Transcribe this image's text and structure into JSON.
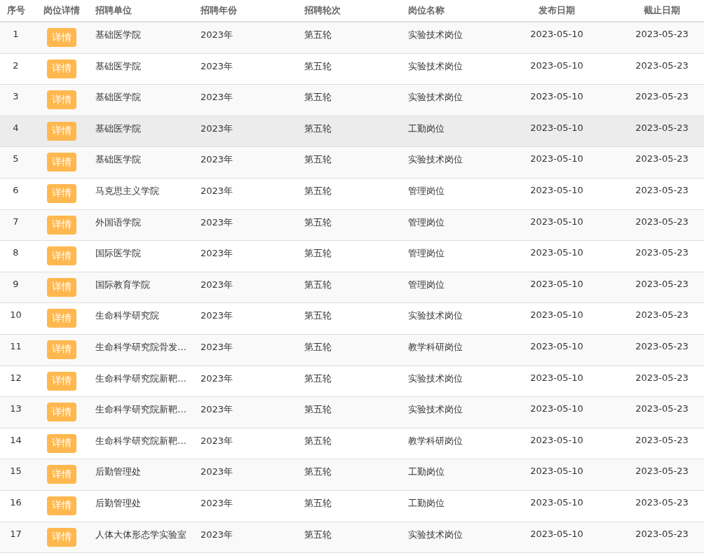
{
  "table": {
    "columns": [
      "序号",
      "岗位详情",
      "招聘单位",
      "招聘年份",
      "招聘轮次",
      "岗位名称",
      "发布日期",
      "截止日期"
    ],
    "rows": [
      {
        "index": "1",
        "button": "详情",
        "unit": "基础医学院",
        "year": "2023年",
        "round": "第五轮",
        "position": "实验技术岗位",
        "published": "2023-05-10",
        "deadline": "2023-05-23",
        "hovered": false
      },
      {
        "index": "2",
        "button": "详情",
        "unit": "基础医学院",
        "year": "2023年",
        "round": "第五轮",
        "position": "实验技术岗位",
        "published": "2023-05-10",
        "deadline": "2023-05-23",
        "hovered": false
      },
      {
        "index": "3",
        "button": "详情",
        "unit": "基础医学院",
        "year": "2023年",
        "round": "第五轮",
        "position": "实验技术岗位",
        "published": "2023-05-10",
        "deadline": "2023-05-23",
        "hovered": false
      },
      {
        "index": "4",
        "button": "详情",
        "unit": "基础医学院",
        "year": "2023年",
        "round": "第五轮",
        "position": "工勤岗位",
        "published": "2023-05-10",
        "deadline": "2023-05-23",
        "hovered": true
      },
      {
        "index": "5",
        "button": "详情",
        "unit": "基础医学院",
        "year": "2023年",
        "round": "第五轮",
        "position": "实验技术岗位",
        "published": "2023-05-10",
        "deadline": "2023-05-23",
        "hovered": false
      },
      {
        "index": "6",
        "button": "详情",
        "unit": "马克思主义学院",
        "year": "2023年",
        "round": "第五轮",
        "position": "管理岗位",
        "published": "2023-05-10",
        "deadline": "2023-05-23",
        "hovered": false
      },
      {
        "index": "7",
        "button": "详情",
        "unit": "外国语学院",
        "year": "2023年",
        "round": "第五轮",
        "position": "管理岗位",
        "published": "2023-05-10",
        "deadline": "2023-05-23",
        "hovered": false
      },
      {
        "index": "8",
        "button": "详情",
        "unit": "国际医学院",
        "year": "2023年",
        "round": "第五轮",
        "position": "管理岗位",
        "published": "2023-05-10",
        "deadline": "2023-05-23",
        "hovered": false
      },
      {
        "index": "9",
        "button": "详情",
        "unit": "国际教育学院",
        "year": "2023年",
        "round": "第五轮",
        "position": "管理岗位",
        "published": "2023-05-10",
        "deadline": "2023-05-23",
        "hovered": false
      },
      {
        "index": "10",
        "button": "详情",
        "unit": "生命科学研究院",
        "year": "2023年",
        "round": "第五轮",
        "position": "实验技术岗位",
        "published": "2023-05-10",
        "deadline": "2023-05-23",
        "hovered": false
      },
      {
        "index": "11",
        "button": "详情",
        "unit": "生命科学研究院骨发…",
        "year": "2023年",
        "round": "第五轮",
        "position": "教学科研岗位",
        "published": "2023-05-10",
        "deadline": "2023-05-23",
        "hovered": false
      },
      {
        "index": "12",
        "button": "详情",
        "unit": "生命科学研究院新靶…",
        "year": "2023年",
        "round": "第五轮",
        "position": "实验技术岗位",
        "published": "2023-05-10",
        "deadline": "2023-05-23",
        "hovered": false
      },
      {
        "index": "13",
        "button": "详情",
        "unit": "生命科学研究院新靶…",
        "year": "2023年",
        "round": "第五轮",
        "position": "实验技术岗位",
        "published": "2023-05-10",
        "deadline": "2023-05-23",
        "hovered": false
      },
      {
        "index": "14",
        "button": "详情",
        "unit": "生命科学研究院新靶…",
        "year": "2023年",
        "round": "第五轮",
        "position": "教学科研岗位",
        "published": "2023-05-10",
        "deadline": "2023-05-23",
        "hovered": false
      },
      {
        "index": "15",
        "button": "详情",
        "unit": "后勤管理处",
        "year": "2023年",
        "round": "第五轮",
        "position": "工勤岗位",
        "published": "2023-05-10",
        "deadline": "2023-05-23",
        "hovered": false
      },
      {
        "index": "16",
        "button": "详情",
        "unit": "后勤管理处",
        "year": "2023年",
        "round": "第五轮",
        "position": "工勤岗位",
        "published": "2023-05-10",
        "deadline": "2023-05-23",
        "hovered": false
      },
      {
        "index": "17",
        "button": "详情",
        "unit": "人体大体形态学实验室",
        "year": "2023年",
        "round": "第五轮",
        "position": "实验技术岗位",
        "published": "2023-05-10",
        "deadline": "2023-05-23",
        "hovered": false
      }
    ]
  }
}
